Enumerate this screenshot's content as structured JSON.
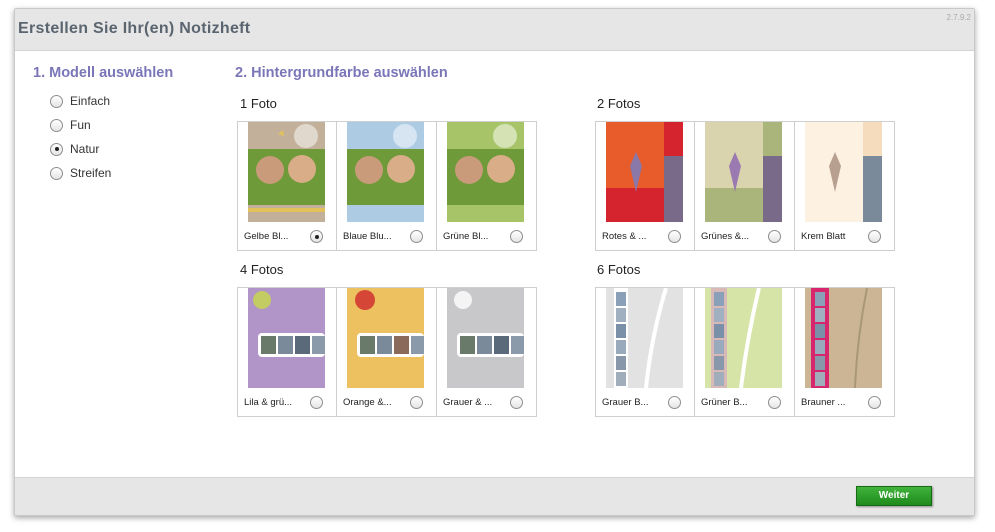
{
  "window": {
    "title": "Erstellen Sie Ihr(en) Notizheft",
    "version": "2.7.9.2"
  },
  "sections": {
    "model_heading": "1. Modell auswählen",
    "color_heading": "2. Hintergrundfarbe auswählen"
  },
  "models": [
    {
      "label": "Einfach",
      "selected": false
    },
    {
      "label": "Fun",
      "selected": false
    },
    {
      "label": "Natur",
      "selected": true
    },
    {
      "label": "Streifen",
      "selected": false
    }
  ],
  "groups": {
    "one_photo": {
      "label": "1 Foto",
      "items": [
        {
          "caption": "Gelbe Bl...",
          "selected": true,
          "bg": "#c2b09a",
          "band": "#e3c15a"
        },
        {
          "caption": "Blaue Blu...",
          "selected": false,
          "bg": "#aecbe4",
          "band": "#aecbe4"
        },
        {
          "caption": "Grüne Bl...",
          "selected": false,
          "bg": "#a8c468",
          "band": "#a8c468"
        }
      ]
    },
    "two_photos": {
      "label": "2 Fotos",
      "items": [
        {
          "caption": "Rotes & ...",
          "selected": false,
          "left": "#e85b2b",
          "right": "#d6242e"
        },
        {
          "caption": "Grünes &...",
          "selected": false,
          "left": "#d9d4ad",
          "right": "#a9b57a"
        },
        {
          "caption": "Krem Blatt",
          "selected": false,
          "left": "#fdf1e1",
          "right": "#f4dcbc"
        }
      ]
    },
    "four_photos": {
      "label": "4 Fotos",
      "items": [
        {
          "caption": "Lila & grü...",
          "selected": false,
          "bg": "#b195c8"
        },
        {
          "caption": "Orange &...",
          "selected": false,
          "bg": "#edc060"
        },
        {
          "caption": "Grauer & ...",
          "selected": false,
          "bg": "#c8c8ca"
        }
      ]
    },
    "six_photos": {
      "label": "6 Fotos",
      "items": [
        {
          "caption": "Grauer B...",
          "selected": false,
          "bg": "#e2e2e2",
          "strip": "#dcdcdc"
        },
        {
          "caption": "Grüner B...",
          "selected": false,
          "bg": "#d6e4a8",
          "strip": "#d9b8b8"
        },
        {
          "caption": "Brauner ...",
          "selected": false,
          "bg": "#cbb594",
          "strip": "#d7266e"
        }
      ]
    }
  },
  "footer": {
    "next_label": "Weiter"
  },
  "colors": {
    "heading": "#7b76b8",
    "button": "#2e9e2a"
  }
}
